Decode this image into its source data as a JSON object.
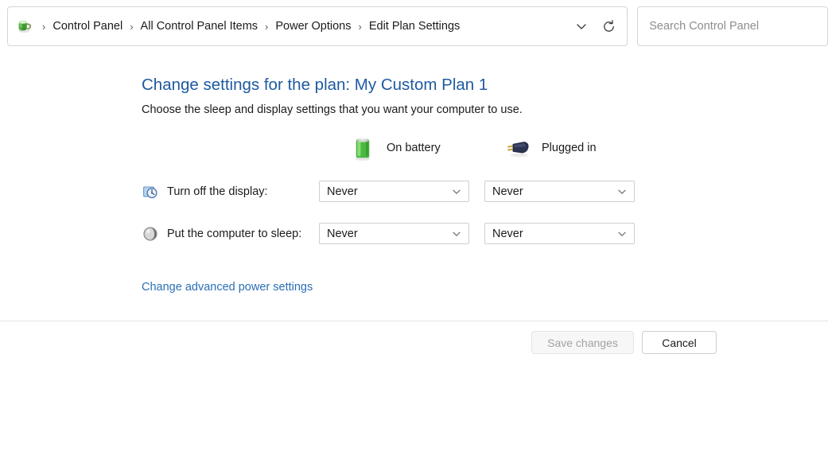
{
  "window": {
    "addressbar": {
      "plan_icon": "power-plan-icon",
      "breadcrumbs": [
        {
          "label": "Control Panel"
        },
        {
          "label": "All Control Panel Items"
        },
        {
          "label": "Power Options"
        },
        {
          "label": "Edit Plan Settings"
        }
      ],
      "separator": "›",
      "history_dropdown_icon": "chevron-down-icon",
      "refresh_icon": "refresh-icon",
      "search": {
        "placeholder": "Search Control Panel",
        "value": ""
      }
    }
  },
  "main": {
    "title": "Change settings for the plan: My Custom Plan 1",
    "subtitle": "Choose the sleep and display settings that you want your computer to use.",
    "columns": [
      {
        "key": "battery",
        "label": "On battery",
        "icon": "battery-icon"
      },
      {
        "key": "plugged",
        "label": "Plugged in",
        "icon": "power-plug-icon"
      }
    ],
    "rows": [
      {
        "key": "display",
        "icon": "display-clock-icon",
        "label": "Turn off the display:",
        "battery_value": "Never",
        "plugged_value": "Never"
      },
      {
        "key": "sleep",
        "icon": "sleep-moon-icon",
        "label": "Put the computer to sleep:",
        "battery_value": "Never",
        "plugged_value": "Never"
      }
    ],
    "dropdown_chevron_icon": "chevron-down-icon",
    "advanced_link": "Change advanced power settings"
  },
  "footer": {
    "save_label": "Save changes",
    "save_enabled": false,
    "cancel_label": "Cancel"
  },
  "colors": {
    "title_blue": "#1e5aa0",
    "link_blue": "#2a6fb5",
    "battery_green": "#4cb84c",
    "plug_navy": "#2c3350",
    "text": "#1b1b1b",
    "border": "#d6d6d6",
    "disabled_text": "#a2a2a2"
  }
}
